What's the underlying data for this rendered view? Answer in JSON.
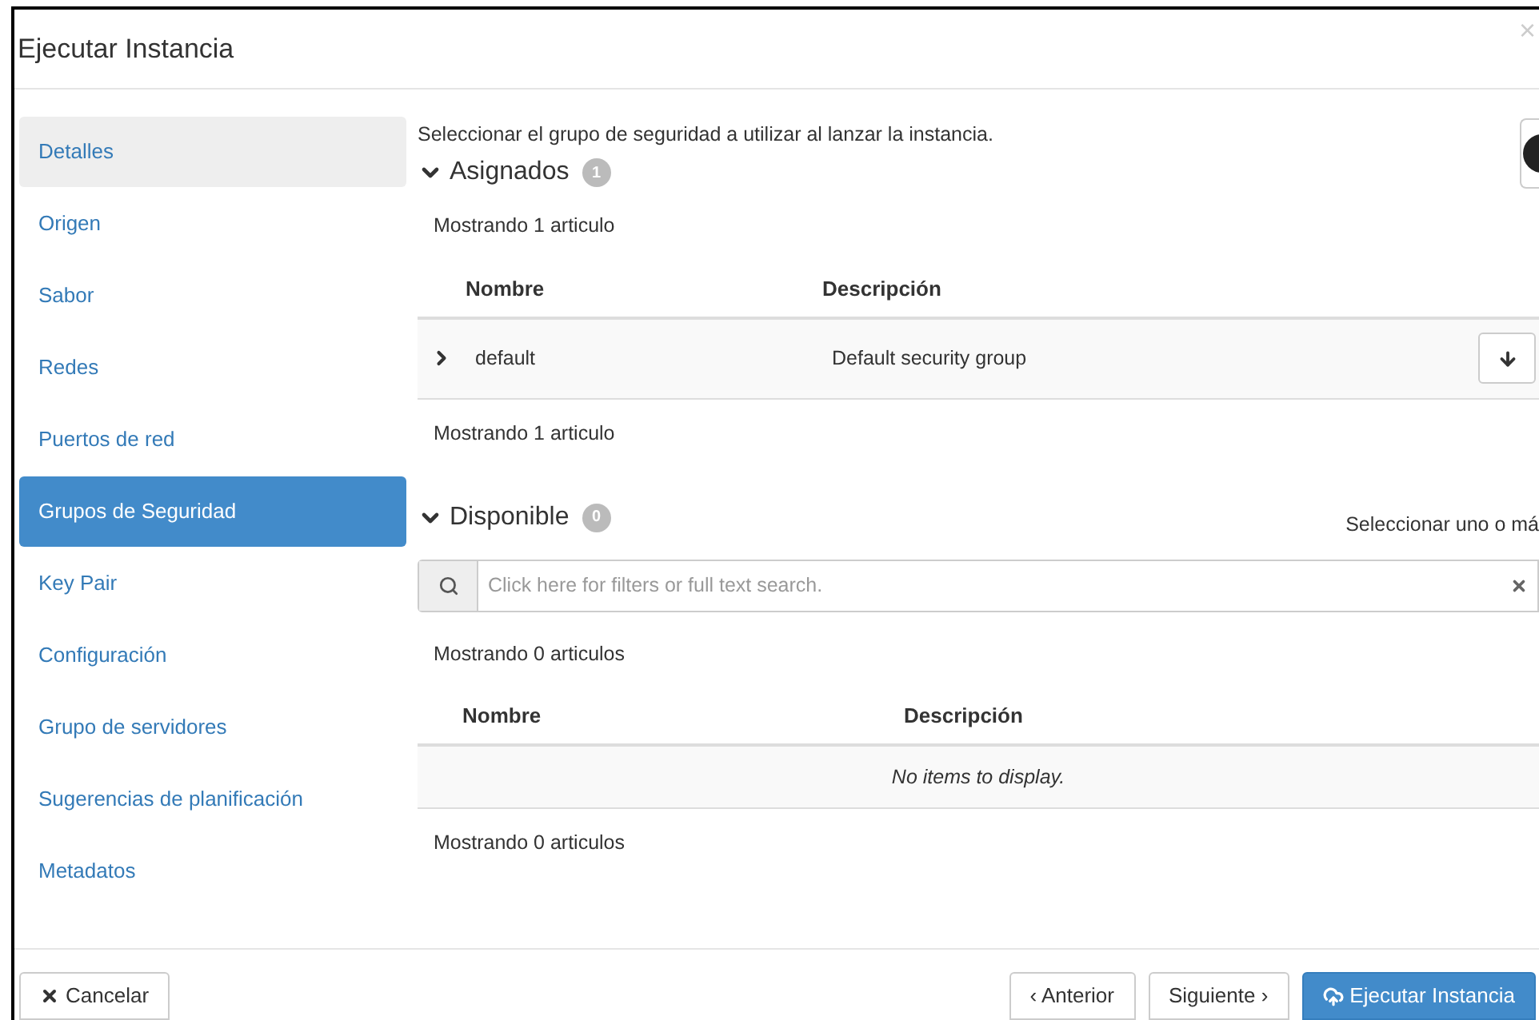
{
  "window": {
    "title": "Ejecutar Instancia",
    "close": "×"
  },
  "sidebar": {
    "items": [
      {
        "label": "Detalles",
        "selected": false,
        "highlighted": true
      },
      {
        "label": "Origen",
        "selected": false,
        "highlighted": false
      },
      {
        "label": "Sabor",
        "selected": false,
        "highlighted": false
      },
      {
        "label": "Redes",
        "selected": false,
        "highlighted": false
      },
      {
        "label": "Puertos de red",
        "selected": false,
        "highlighted": false
      },
      {
        "label": "Grupos de Seguridad",
        "selected": true,
        "highlighted": false
      },
      {
        "label": "Key Pair",
        "selected": false,
        "highlighted": false
      },
      {
        "label": "Configuración",
        "selected": false,
        "highlighted": false
      },
      {
        "label": "Grupo de servidores",
        "selected": false,
        "highlighted": false
      },
      {
        "label": "Sugerencias de planificación",
        "selected": false,
        "highlighted": false
      },
      {
        "label": "Metadatos",
        "selected": false,
        "highlighted": false
      }
    ]
  },
  "intro": "Seleccionar el grupo de seguridad a utilizar al lanzar la instancia.",
  "assigned": {
    "title": "Asignados",
    "count": "1",
    "expanded": true,
    "shown_top": "Mostrando 1 articulo",
    "columns": [
      "Nombre",
      "Descripción"
    ],
    "rows": [
      {
        "name": "default",
        "description": "Default security group",
        "expanded": false
      }
    ],
    "shown_bottom": "Mostrando 1 articulo"
  },
  "available": {
    "title": "Disponible",
    "count": "0",
    "expanded": true,
    "hint": "Seleccionar uno o má",
    "search": {
      "placeholder": "Click here for filters or full text search."
    },
    "shown_top": "Mostrando 0 articulos",
    "columns": [
      "Nombre",
      "Descripción"
    ],
    "empty": "No items to display.",
    "shown_bottom": "Mostrando 0 articulos"
  },
  "footer": {
    "buttons": [
      {
        "label": "Cancelar",
        "kind": "cancel"
      },
      {
        "label": "‹ Anterior",
        "kind": "default"
      },
      {
        "label": "Siguiente ›",
        "kind": "default"
      },
      {
        "label": "Ejecutar Instancia",
        "kind": "primary"
      }
    ]
  }
}
